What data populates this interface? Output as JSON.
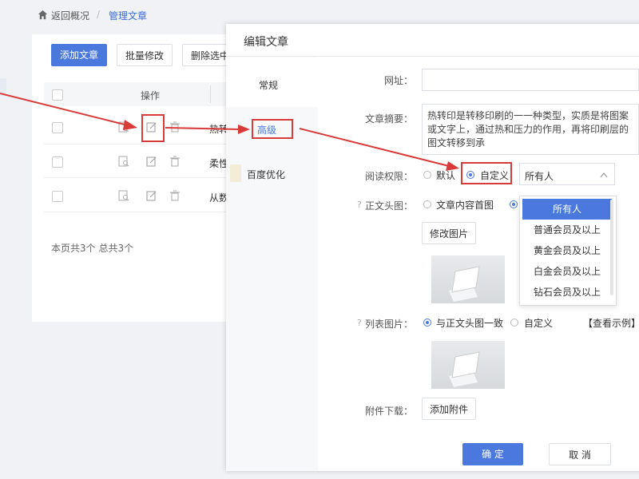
{
  "breadcrumb": {
    "home": "返回概况",
    "separator": "/",
    "current": "管理文章"
  },
  "toolbar": {
    "add": "添加文章",
    "batch_edit": "批量修改",
    "delete_selected": "删除选中"
  },
  "table": {
    "header_action": "操作",
    "rows": [
      {
        "title": "热转"
      },
      {
        "title": "柔性"
      },
      {
        "title": "从数"
      }
    ],
    "footer": "本页共3个  总共3个"
  },
  "modal": {
    "title": "编辑文章",
    "tabs": [
      "常规",
      "高级",
      "百度优化"
    ],
    "labels": {
      "url": "网址：",
      "summary": "文章摘要：",
      "access": "阅读权限：",
      "header_image": "正文头图：",
      "list_image": "列表图片：",
      "attachment": "附件下载："
    },
    "summary_text": "热转印是转移印刷的一一种类型，实质是将图案或文字上，通过热和压力的作用，再将印刷层的图文转移到承",
    "access_options": {
      "default": "默认",
      "custom": "自定义"
    },
    "access_selected": "所有人",
    "access_dropdown": [
      "所有人",
      "普通会员及以上",
      "黄金会员及以上",
      "白金会员及以上",
      "钻石会员及以上"
    ],
    "header_image_option": "文章内容首图",
    "change_image": "修改图片",
    "list_image_options": {
      "same": "与正文头图一致",
      "custom": "自定义"
    },
    "view_example": "【查看示例】",
    "add_attachment": "添加附件",
    "confirm": "确 定",
    "cancel": "取 消"
  },
  "colors": {
    "primary": "#4a78dd",
    "annotation": "#d93a3a"
  }
}
